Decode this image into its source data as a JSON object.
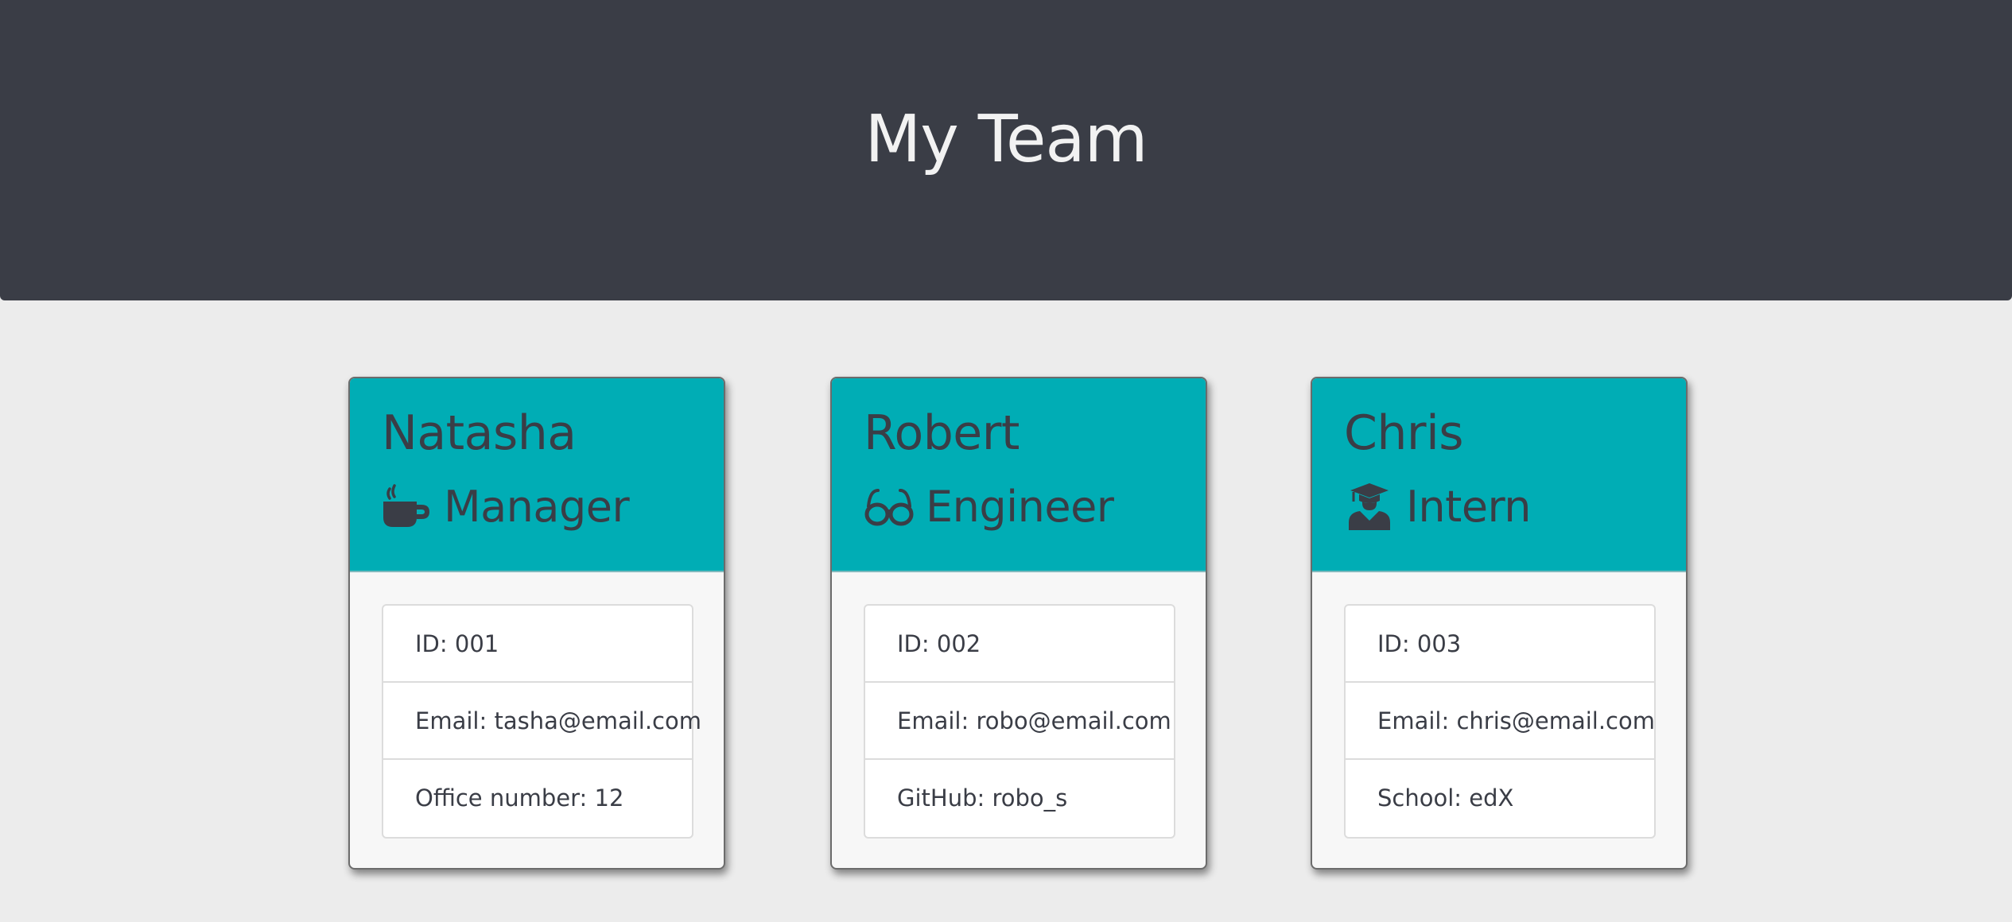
{
  "header": {
    "title": "My Team"
  },
  "team": [
    {
      "name": "Natasha",
      "role": "Manager",
      "icon": "coffee-mug-icon",
      "details": [
        {
          "label": "ID: 001"
        },
        {
          "label": "Email: tasha@email.com"
        },
        {
          "label": "Office number: 12"
        }
      ]
    },
    {
      "name": "Robert",
      "role": "Engineer",
      "icon": "glasses-icon",
      "details": [
        {
          "label": "ID: 002"
        },
        {
          "label": "Email: robo@email.com"
        },
        {
          "label": "GitHub: robo_s"
        }
      ]
    },
    {
      "name": "Chris",
      "role": "Intern",
      "icon": "graduate-icon",
      "details": [
        {
          "label": "ID: 003"
        },
        {
          "label": "Email: chris@email.com"
        },
        {
          "label": "School: edX"
        }
      ]
    }
  ],
  "colors": {
    "header_bg": "#3a3d46",
    "card_header_bg": "#00adb5",
    "page_bg": "#ececec",
    "text": "#3a3d46"
  }
}
